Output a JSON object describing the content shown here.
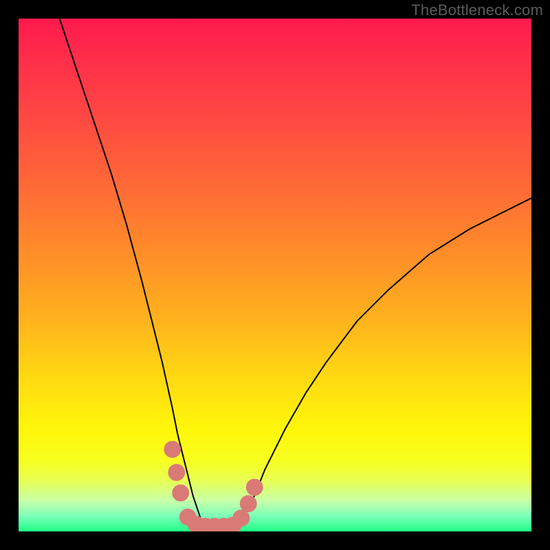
{
  "watermark": "TheBottleneck.com",
  "colors": {
    "frame": "#000000",
    "curve": "#000000",
    "markers": "#d97a77",
    "gradient_top": "#ff1a4d",
    "gradient_bottom": "#1eff87"
  },
  "chart_data": {
    "type": "line",
    "title": "",
    "xlabel": "",
    "ylabel": "",
    "xlim": [
      0,
      100
    ],
    "ylim": [
      0,
      100
    ],
    "grid": false,
    "legend": false,
    "description": "Bottleneck curve. Y axis represents bottleneck percentage (0 at bottom, 100 at top). Curve plunges steeply from top-left, reaches ~0% near x≈36, stays ~0% until x≈42, then rises with decreasing slope toward the right edge, exiting near y≈65 at x=100. Pink bead markers cluster around the trough.",
    "series": [
      {
        "name": "bottleneck",
        "x": [
          8,
          10,
          12,
          15,
          18,
          21,
          24,
          26,
          28,
          30,
          31,
          32,
          33,
          34,
          35,
          36,
          38,
          40,
          42,
          43,
          44,
          46,
          48,
          52,
          56,
          60,
          66,
          72,
          80,
          88,
          96,
          100
        ],
        "y": [
          100,
          94,
          88,
          79,
          70,
          60,
          49,
          41,
          33,
          24,
          19,
          15,
          11,
          7,
          4,
          1,
          0,
          0,
          0,
          1,
          3,
          7,
          12,
          20,
          27,
          33,
          41,
          47,
          54,
          59,
          63,
          65
        ]
      }
    ],
    "markers": {
      "name": "trough-beads",
      "radius_pct": 1.6,
      "points": [
        {
          "x": 30.0,
          "y": 16.0
        },
        {
          "x": 30.8,
          "y": 11.5
        },
        {
          "x": 31.6,
          "y": 7.5
        },
        {
          "x": 33.0,
          "y": 2.8
        },
        {
          "x": 34.6,
          "y": 1.4
        },
        {
          "x": 36.4,
          "y": 1.0
        },
        {
          "x": 38.2,
          "y": 1.0
        },
        {
          "x": 40.0,
          "y": 1.0
        },
        {
          "x": 41.8,
          "y": 1.2
        },
        {
          "x": 43.4,
          "y": 2.6
        },
        {
          "x": 44.8,
          "y": 5.4
        },
        {
          "x": 46.0,
          "y": 8.6
        }
      ]
    }
  }
}
